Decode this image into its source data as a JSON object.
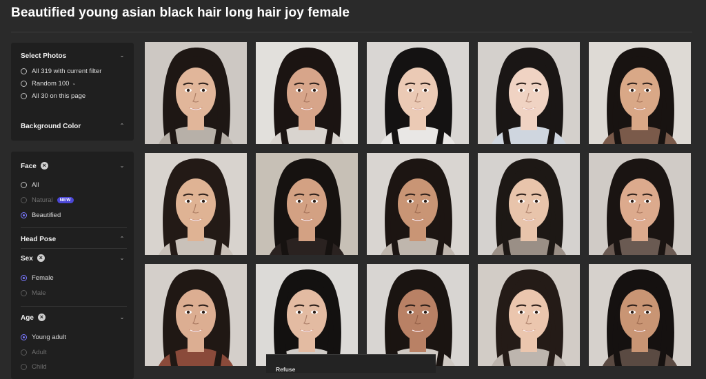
{
  "page_title": "Beautified young asian black hair long hair joy female",
  "select_photos": {
    "heading": "Select Photos",
    "options": [
      "All 319 with current filter",
      "Random 100",
      "All 30 on this page"
    ]
  },
  "background_color": {
    "heading": "Background Color"
  },
  "face": {
    "heading": "Face",
    "options": [
      "All",
      "Natural",
      "Beautified"
    ],
    "new_badge": "NEW",
    "selected": "Beautified"
  },
  "head_pose": {
    "heading": "Head Pose"
  },
  "sex": {
    "heading": "Sex",
    "options": [
      "Female",
      "Male"
    ],
    "selected": "Female"
  },
  "age": {
    "heading": "Age",
    "options": [
      "Young adult",
      "Adult",
      "Child"
    ],
    "selected": "Young adult"
  },
  "bottom_bar": {
    "label": "Refuse"
  },
  "colors": {
    "accent": "#7a78ff",
    "badge": "#4b47d6",
    "background": "#2a2a2a",
    "panel": "#1f1f1f"
  },
  "photos": [
    {
      "bg": "#cdc8c3",
      "skin": "#e1b69a",
      "hair": "#1e1714",
      "cloth": "#b7b0a8"
    },
    {
      "bg": "#e2e0dc",
      "skin": "#d7a58a",
      "hair": "#1b1412",
      "cloth": "#d9d4cf"
    },
    {
      "bg": "#d9d6d3",
      "skin": "#ebcab5",
      "hair": "#141212",
      "cloth": "#e9e7e5"
    },
    {
      "bg": "#d4d0cc",
      "skin": "#f0d3c3",
      "hair": "#1a1615",
      "cloth": "#cfd6df"
    },
    {
      "bg": "#dedad5",
      "skin": "#d9a887",
      "hair": "#181311",
      "cloth": "#7a5a4a"
    },
    {
      "bg": "#d8d3ce",
      "skin": "#dfb394",
      "hair": "#231a16",
      "cloth": "#c9c1b9"
    },
    {
      "bg": "#c7c0b6",
      "skin": "#d3a183",
      "hair": "#161210",
      "cloth": "#2a2220"
    },
    {
      "bg": "#d9d5d1",
      "skin": "#c99575",
      "hair": "#1c1512",
      "cloth": "#bfb6ad"
    },
    {
      "bg": "#d5d2cf",
      "skin": "#e8c4ab",
      "hair": "#1d1815",
      "cloth": "#9a8f86"
    },
    {
      "bg": "#d0cbc6",
      "skin": "#dcaa8d",
      "hair": "#1a1412",
      "cloth": "#6a5a52"
    },
    {
      "bg": "#d4cfca",
      "skin": "#dcae92",
      "hair": "#201814",
      "cloth": "#8a4a3a"
    },
    {
      "bg": "#dcdad7",
      "skin": "#e3bba2",
      "hair": "#131110",
      "cloth": "#d0ccc8"
    },
    {
      "bg": "#d8d5d2",
      "skin": "#b98165",
      "hair": "#1a1411",
      "cloth": "#cfc9c3"
    },
    {
      "bg": "#d2ccc6",
      "skin": "#ebc6ae",
      "hair": "#241b17",
      "cloth": "#bdb5ae"
    },
    {
      "bg": "#d6d1cc",
      "skin": "#c99574",
      "hair": "#151110",
      "cloth": "#5a4a42"
    }
  ]
}
